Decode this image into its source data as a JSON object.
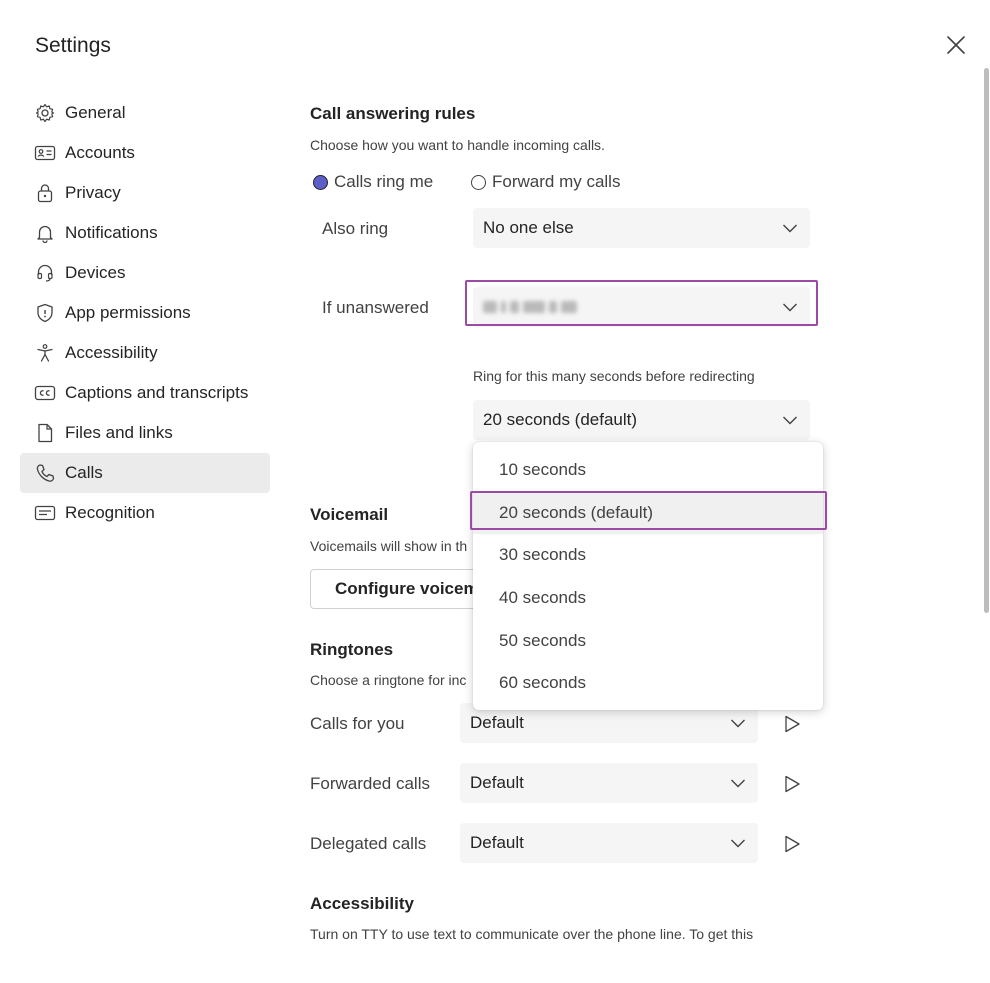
{
  "window": {
    "title": "Settings"
  },
  "nav": {
    "items": [
      {
        "label": "General",
        "icon": "gear-icon"
      },
      {
        "label": "Accounts",
        "icon": "id-card-icon"
      },
      {
        "label": "Privacy",
        "icon": "lock-icon"
      },
      {
        "label": "Notifications",
        "icon": "bell-icon"
      },
      {
        "label": "Devices",
        "icon": "headset-icon"
      },
      {
        "label": "App permissions",
        "icon": "shield-icon"
      },
      {
        "label": "Accessibility",
        "icon": "accessibility-icon"
      },
      {
        "label": "Captions and transcripts",
        "icon": "cc-icon"
      },
      {
        "label": "Files and links",
        "icon": "document-icon"
      },
      {
        "label": "Calls",
        "icon": "phone-icon"
      },
      {
        "label": "Recognition",
        "icon": "recognition-icon"
      }
    ],
    "active_index": 9
  },
  "call_answering": {
    "heading": "Call answering rules",
    "description": "Choose how you want to handle incoming calls.",
    "radio_ring": "Calls ring me",
    "radio_forward": "Forward my calls",
    "selected_radio": "Calls ring me",
    "also_ring_label": "Also ring",
    "also_ring_value": "No one else",
    "if_unanswered_label": "If unanswered",
    "ring_seconds_label": "Ring for this many seconds before redirecting",
    "ring_seconds_value": "20 seconds (default)"
  },
  "ring_dropdown": {
    "options": [
      "10 seconds",
      "20 seconds (default)",
      "30 seconds",
      "40 seconds",
      "50 seconds",
      "60 seconds"
    ],
    "selected_index": 1
  },
  "voicemail": {
    "heading": "Voicemail",
    "description": "Voicemails will show in th",
    "button": "Configure voicem"
  },
  "ringtones": {
    "heading": "Ringtones",
    "description": "Choose a ringtone for inc",
    "rows": [
      {
        "label": "Calls for you",
        "value": "Default"
      },
      {
        "label": "Forwarded calls",
        "value": "Default"
      },
      {
        "label": "Delegated calls",
        "value": "Default"
      }
    ]
  },
  "accessibility": {
    "heading": "Accessibility",
    "description": "Turn on TTY to use text to communicate over the phone line. To get this"
  },
  "colors": {
    "accent": "#5b5fc7",
    "highlight": "#9b4aa6",
    "active_nav_bg": "#ebebeb",
    "select_bg": "#f5f5f5"
  }
}
